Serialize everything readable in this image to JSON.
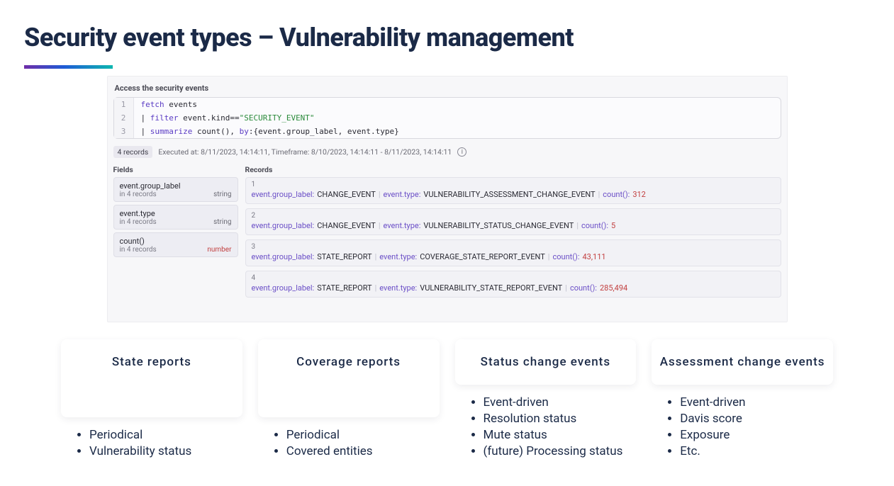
{
  "title": "Security event types – Vulnerability management",
  "panel": {
    "caption": "Access the security events",
    "code": {
      "l1_kw": "fetch",
      "l1_rest": " events",
      "l2_pipe": "| ",
      "l2_kw": "filter",
      "l2_mid": " event.kind==",
      "l2_str": "\"SECURITY_EVENT\"",
      "l3_pipe": "| ",
      "l3_kw": "summarize",
      "l3_mid": " count(), ",
      "l3_kw2": "by",
      "l3_rest": ":{event.group_label, event.type}",
      "ln1": "1",
      "ln2": "2",
      "ln3": "3"
    },
    "records_badge": "4 records",
    "exec_text": "Executed at: 8/11/2023, 14:14:11, Timeframe: 8/10/2023, 14:14:11 - 8/11/2023, 14:14:11",
    "fields_header": "Fields",
    "records_header": "Records",
    "fields": [
      {
        "name": "event.group_label",
        "sub": "in 4 records",
        "type": "string",
        "type_class": "type-string"
      },
      {
        "name": "event.type",
        "sub": "in 4 records",
        "type": "string",
        "type_class": "type-string"
      },
      {
        "name": "count()",
        "sub": "in 4 records",
        "type": "number",
        "type_class": "type-number"
      }
    ],
    "records": [
      {
        "idx": "1",
        "group_key": "event.group_label:",
        "group_val": " CHANGE_EVENT",
        "type_key": "event.type:",
        "type_val": " VULNERABILITY_ASSESSMENT_CHANGE_EVENT",
        "count_key": "count():",
        "count_val": " 312"
      },
      {
        "idx": "2",
        "group_key": "event.group_label:",
        "group_val": " CHANGE_EVENT",
        "type_key": "event.type:",
        "type_val": " VULNERABILITY_STATUS_CHANGE_EVENT",
        "count_key": "count():",
        "count_val": " 5"
      },
      {
        "idx": "3",
        "group_key": "event.group_label:",
        "group_val": " STATE_REPORT",
        "type_key": "event.type:",
        "type_val": " COVERAGE_STATE_REPORT_EVENT",
        "count_key": "count():",
        "count_val": " 43,111"
      },
      {
        "idx": "4",
        "group_key": "event.group_label:",
        "group_val": " STATE_REPORT",
        "type_key": "event.type:",
        "type_val": " VULNERABILITY_STATE_REPORT_EVENT",
        "count_key": "count():",
        "count_val": " 285,494"
      }
    ]
  },
  "cards": [
    {
      "title": "State reports",
      "bullets": [
        "Periodical",
        "Vulnerability status"
      ]
    },
    {
      "title": "Coverage reports",
      "bullets": [
        "Periodical",
        "Covered entities"
      ]
    },
    {
      "title": "Status change events",
      "bullets": [
        "Event-driven",
        "Resolution status",
        "Mute status",
        "(future) Processing status"
      ]
    },
    {
      "title": "Assessment change events",
      "bullets": [
        "Event-driven",
        "Davis score",
        "Exposure",
        "Etc."
      ]
    }
  ]
}
